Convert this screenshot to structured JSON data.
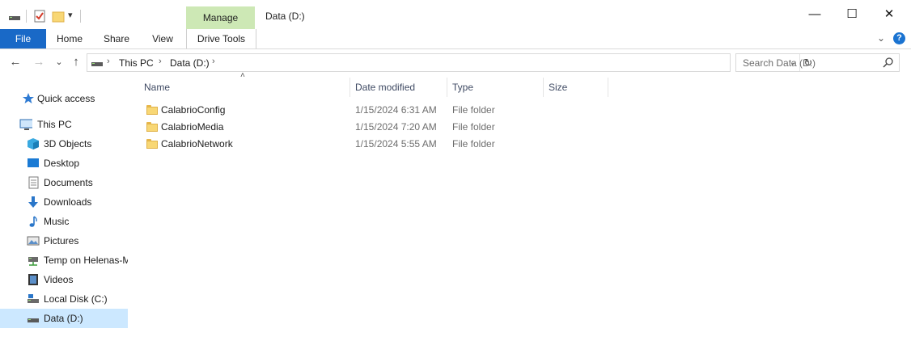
{
  "window": {
    "title": "Data (D:)",
    "manage_tab": "Manage",
    "minimize": "—",
    "maximize": "☐",
    "close": "✕"
  },
  "ribbon": {
    "tabs": [
      "File",
      "Home",
      "Share",
      "View",
      "Drive Tools"
    ],
    "collapse_glyph": "⌄",
    "help_glyph": "?"
  },
  "address": {
    "back": "←",
    "forward": "→",
    "recent": "⌄",
    "up": "↑",
    "crumbs": [
      "This PC",
      "Data (D:)"
    ],
    "separator": "›",
    "dropdown": "⌄",
    "refresh": "↻",
    "search_placeholder": "Search Data (D:)"
  },
  "nav": {
    "items": [
      {
        "label": "Quick access",
        "icon": "star-icon"
      },
      {
        "label": "This PC",
        "icon": "pc-icon"
      },
      {
        "label": "3D Objects",
        "icon": "cube-icon"
      },
      {
        "label": "Desktop",
        "icon": "desktop-icon"
      },
      {
        "label": "Documents",
        "icon": "document-icon"
      },
      {
        "label": "Downloads",
        "icon": "download-icon"
      },
      {
        "label": "Music",
        "icon": "music-icon"
      },
      {
        "label": "Pictures",
        "icon": "picture-icon"
      },
      {
        "label": "Temp on Helenas-M",
        "icon": "network-drive-icon"
      },
      {
        "label": "Videos",
        "icon": "video-icon"
      },
      {
        "label": "Local Disk (C:)",
        "icon": "disk-icon"
      },
      {
        "label": "Data (D:)",
        "icon": "drive-icon"
      }
    ],
    "selected": "Data (D:)"
  },
  "columns": {
    "name": "Name",
    "date": "Date modified",
    "type": "Type",
    "size": "Size",
    "sort_indicator": "˄"
  },
  "files": [
    {
      "name": "CalabrioConfig",
      "date": "1/15/2024 6:31 AM",
      "type": "File folder"
    },
    {
      "name": "CalabrioMedia",
      "date": "1/15/2024 7:20 AM",
      "type": "File folder"
    },
    {
      "name": "CalabrioNetwork",
      "date": "1/15/2024 5:55 AM",
      "type": "File folder"
    }
  ],
  "colors": {
    "file_tab": "#1969c7",
    "manage_tab": "#cde8b5",
    "selection": "#cce8ff"
  }
}
